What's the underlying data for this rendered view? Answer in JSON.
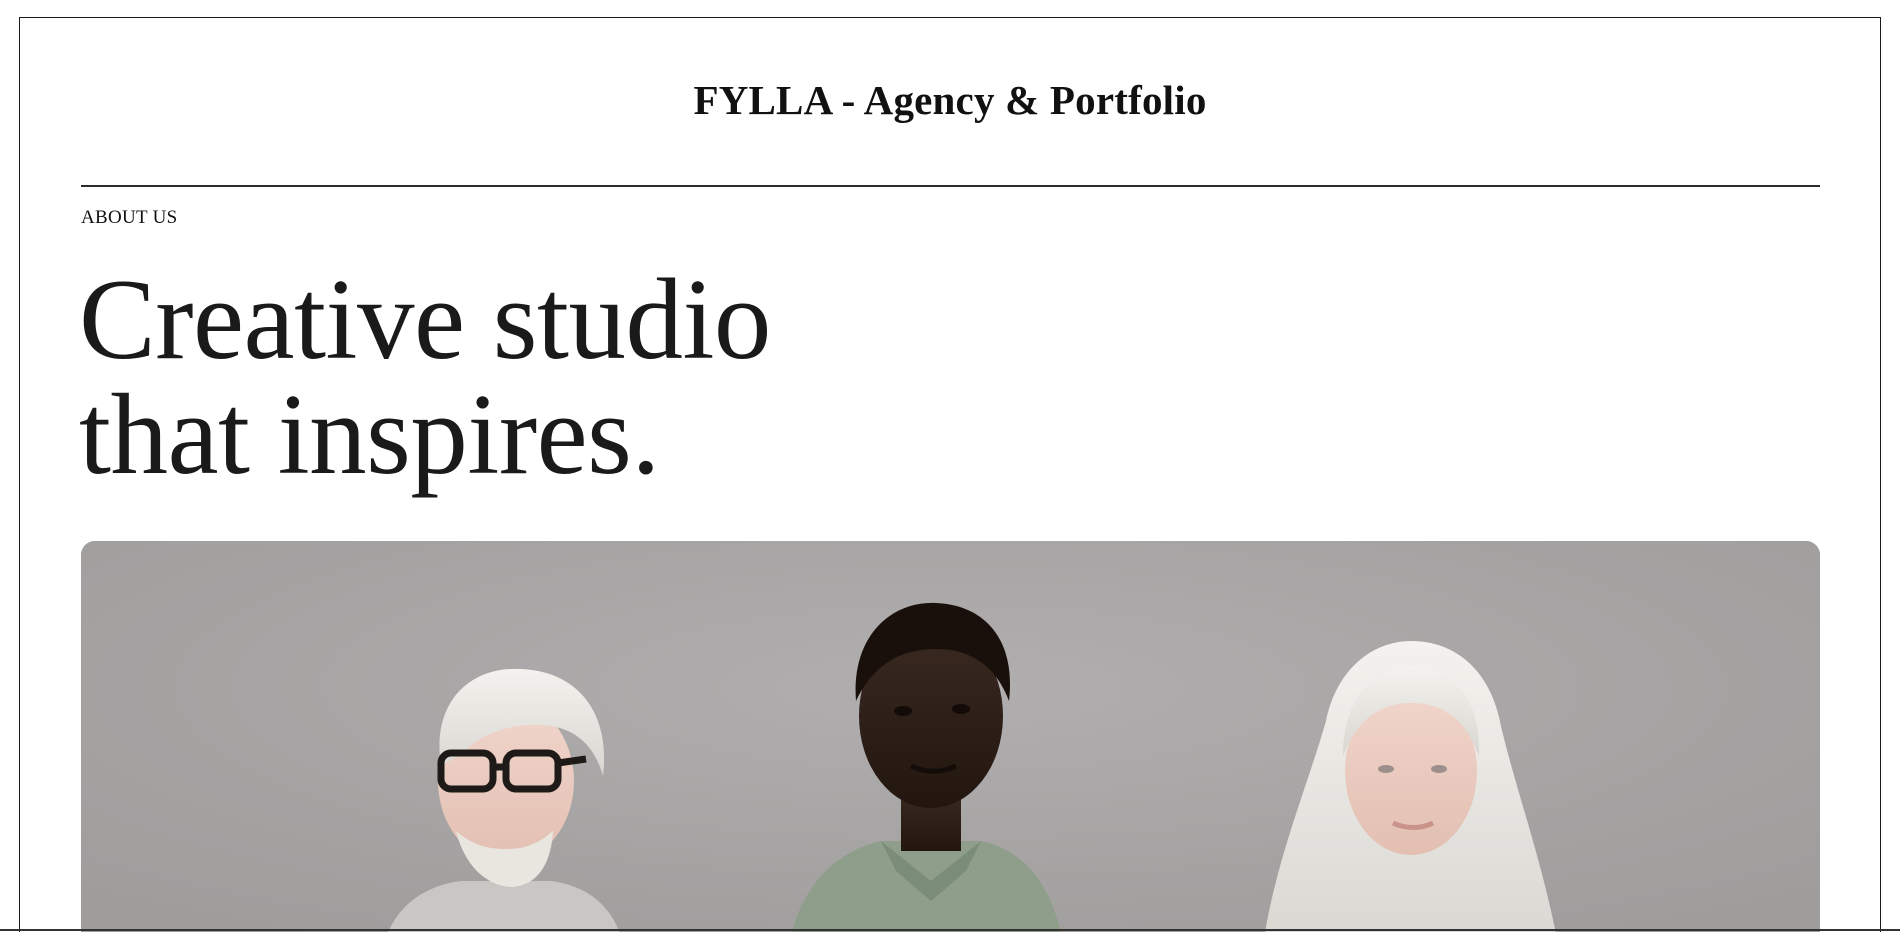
{
  "site": {
    "title": "FYLLA - Agency & Portfolio"
  },
  "hero": {
    "eyebrow": "ABOUT US",
    "heading_line_1": "Creative studio",
    "heading_line_2": "that inspires.",
    "image": {
      "subject": "three-people-portrait-photo"
    }
  },
  "colors": {
    "background": "#ffffff",
    "text": "#111111",
    "photo_wall": "#a8a6a5"
  }
}
